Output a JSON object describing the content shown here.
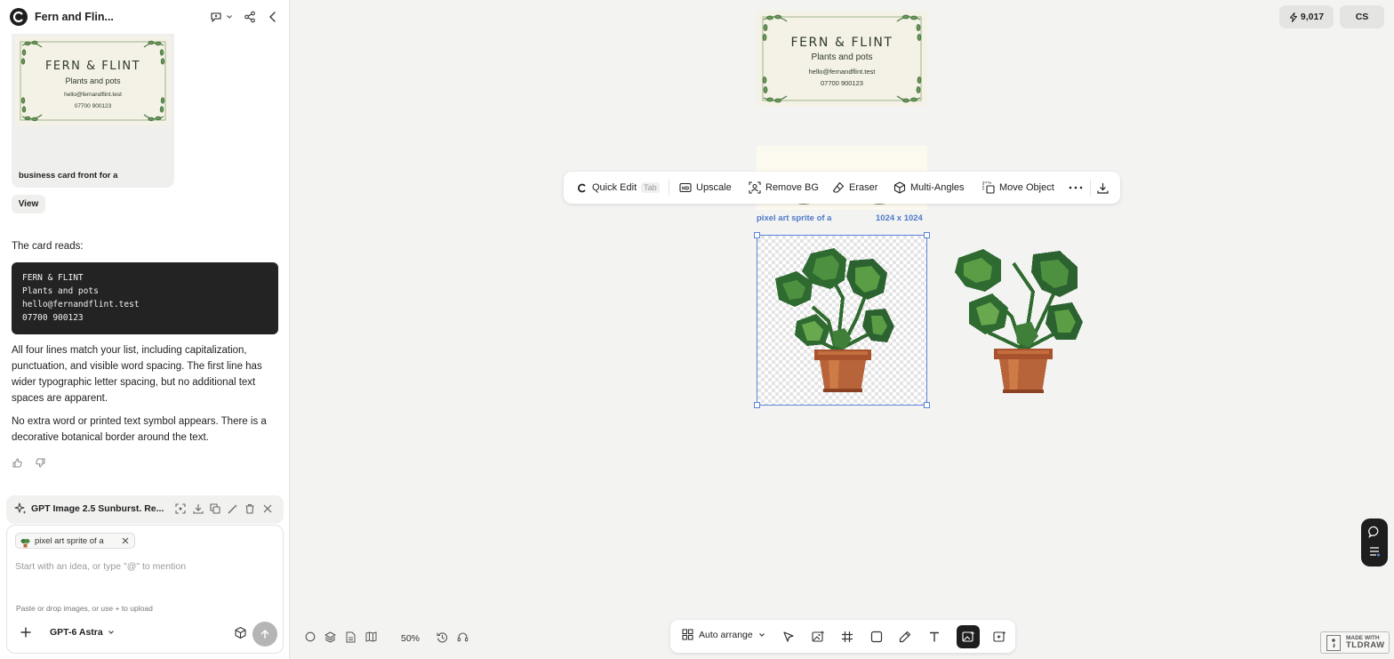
{
  "app": {
    "title": "Fern and Flin..."
  },
  "business_card": {
    "name": "FERN & FLINT",
    "tagline": "Plants and pots",
    "email": "hello@fernandflint.test",
    "phone": "07700 900123"
  },
  "chat": {
    "image_caption": "business card front for a",
    "view_button": "View",
    "intro": "The card reads:",
    "code_lines": [
      "FERN & FLINT",
      "Plants and pots",
      "hello@fernandflint.test",
      "07700 900123"
    ],
    "paragraph1": "All four lines match your list, including capitalization, punctuation, and visible word spacing. The first line has wider typographic letter spacing, but no additional text spaces are apparent.",
    "paragraph2": "No extra word or printed text symbol appears. There is a decorative botanical border around the text."
  },
  "model_bar": {
    "name": "GPT Image 2.5 Sunburst. Re..."
  },
  "composer": {
    "chip_label": "pixel art sprite of a",
    "placeholder": "Start with an idea, or type \"@\" to mention",
    "upload_hint": "Paste or drop images, or use + to upload",
    "model_select": "GPT-6 Astra"
  },
  "canvas": {
    "credits": "9,017",
    "avatar": "CS",
    "selected_label": "pixel art sprite of a",
    "selected_size": "1024 x 1024",
    "zoom": "50%"
  },
  "toolbar": {
    "quick_edit": "Quick Edit",
    "tab_hint": "Tab",
    "upscale": "Upscale",
    "remove_bg": "Remove BG",
    "eraser": "Eraser",
    "multi_angles": "Multi-Angles",
    "move_object": "Move Object"
  },
  "bottom_toolbar": {
    "auto_arrange": "Auto arrange"
  },
  "footer": {
    "made_with_line1": "MADE WITH",
    "made_with_line2": "TLDRAW"
  },
  "colors": {
    "selection": "#5b83d8",
    "accent_dark": "#1e1e1e",
    "leaf_green": "#3d7a3a",
    "pot": "#b8643a"
  }
}
